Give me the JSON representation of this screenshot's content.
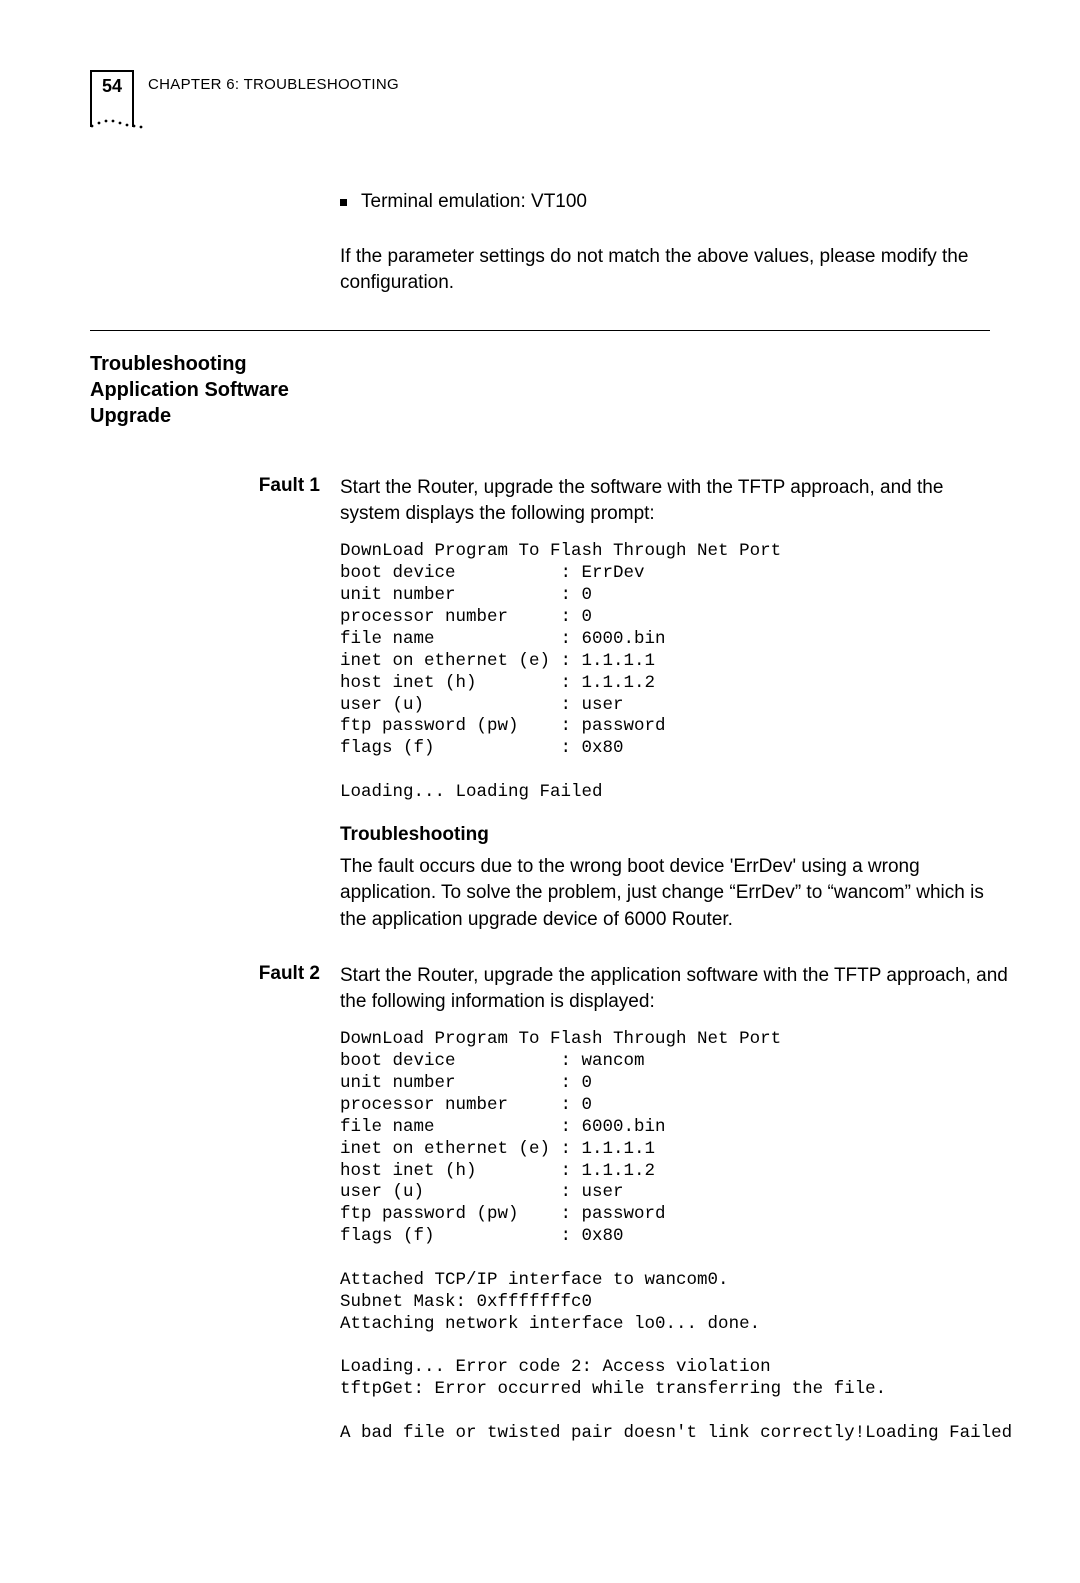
{
  "header": {
    "page_number": "54",
    "chapter_line": "CHAPTER 6: TROUBLESHOOTING"
  },
  "top": {
    "bullet": "Terminal emulation: VT100",
    "note": "If the parameter settings do not match the above values, please modify the configuration."
  },
  "section_heading": "Troubleshooting Application Software Upgrade",
  "fault1": {
    "label": "Fault 1",
    "intro": "Start the Router, upgrade the software with the TFTP approach, and the system displays the following prompt:",
    "terminal": "DownLoad Program To Flash Through Net Port\nboot device          : ErrDev\nunit number          : 0\nprocessor number     : 0\nfile name            : 6000.bin\ninet on ethernet (e) : 1.1.1.1\nhost inet (h)        : 1.1.1.2\nuser (u)             : user\nftp password (pw)    : password\nflags (f)            : 0x80\n\nLoading... Loading Failed",
    "troubleshooting_heading": "Troubleshooting",
    "troubleshooting_text": "The fault occurs due to the wrong boot device 'ErrDev' using a wrong application. To solve the problem, just change “ErrDev” to “wancom” which is the application upgrade device of 6000 Router."
  },
  "fault2": {
    "label": "Fault 2",
    "intro": "Start the Router, upgrade the application software with the TFTP approach, and the following information is displayed:",
    "terminal": "DownLoad Program To Flash Through Net Port\nboot device          : wancom\nunit number          : 0\nprocessor number     : 0\nfile name            : 6000.bin\ninet on ethernet (e) : 1.1.1.1\nhost inet (h)        : 1.1.1.2\nuser (u)             : user\nftp password (pw)    : password\nflags (f)            : 0x80\n\nAttached TCP/IP interface to wancom0.\nSubnet Mask: 0xfffffffc0\nAttaching network interface lo0... done.\n\nLoading... Error code 2: Access violation\ntftpGet: Error occurred while transferring the file.\n\nA bad file or twisted pair doesn't link correctly!Loading Failed"
  }
}
